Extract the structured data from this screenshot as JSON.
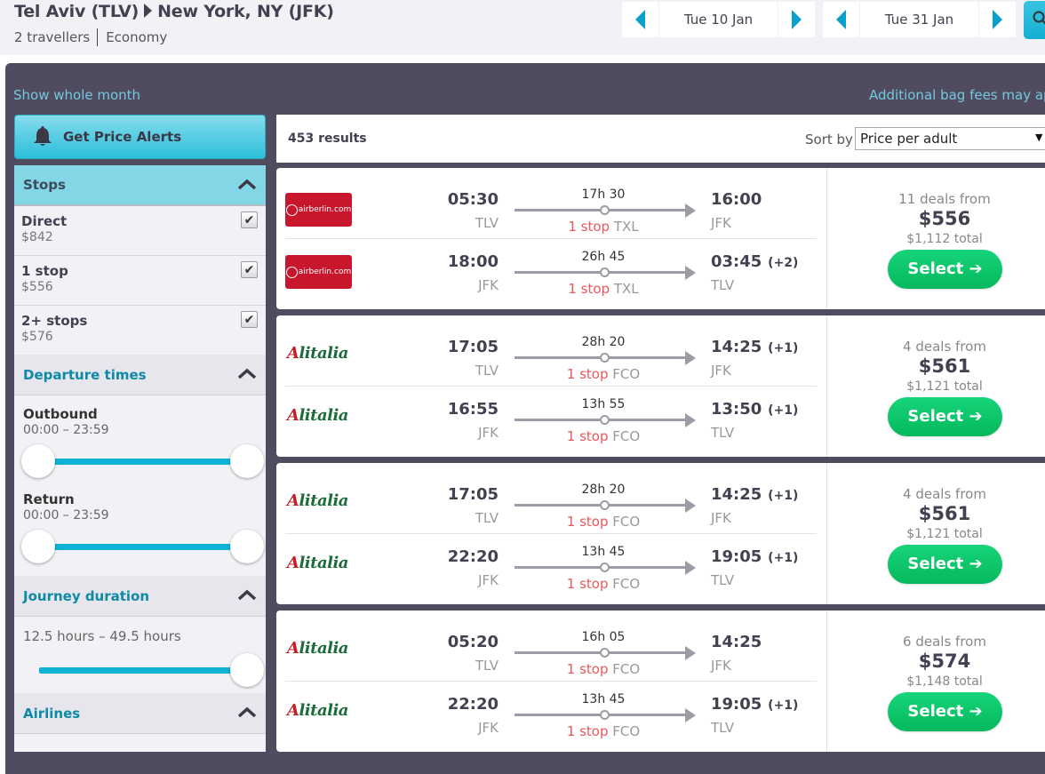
{
  "header": {
    "origin": "Tel Aviv (TLV)",
    "destination": "New York, NY (JFK)",
    "travellers": "2 travellers",
    "cabin": "Economy",
    "outbound_date": "Tue 10 Jan",
    "return_date": "Tue 31 Jan",
    "search_icon": "search-icon"
  },
  "links": {
    "show_whole_month": "Show whole month",
    "bag_fees": "Additional bag fees may apply"
  },
  "sidebar": {
    "price_alerts_label": "Get Price Alerts",
    "stops": {
      "title": "Stops",
      "options": [
        {
          "label": "Direct",
          "price": "$842",
          "checked": true
        },
        {
          "label": "1 stop",
          "price": "$556",
          "checked": true
        },
        {
          "label": "2+ stops",
          "price": "$576",
          "checked": true
        }
      ]
    },
    "departure_times": {
      "title": "Departure times",
      "outbound_label": "Outbound",
      "outbound_range": "00:00 – 23:59",
      "return_label": "Return",
      "return_range": "00:00 – 23:59"
    },
    "journey_duration": {
      "title": "Journey duration",
      "range": "12.5 hours – 49.5 hours"
    },
    "airlines": {
      "title": "Airlines"
    }
  },
  "results": {
    "count": "453 results",
    "sort_label": "Sort by",
    "sort_value": "Price per adult",
    "select_label": "Select ➔",
    "cards": [
      {
        "deals": "11 deals from",
        "price": "$556",
        "total": "$1,112 total",
        "legs": [
          {
            "airline": "airberlin.com",
            "dep_time": "05:30",
            "dep_airport": "TLV",
            "duration": "17h 30",
            "stops": "1 stop",
            "via": "TXL",
            "arr_time": "16:00",
            "day_offset": "",
            "arr_airport": "JFK"
          },
          {
            "airline": "airberlin.com",
            "dep_time": "18:00",
            "dep_airport": "JFK",
            "duration": "26h 45",
            "stops": "1 stop",
            "via": "TXL",
            "arr_time": "03:45",
            "day_offset": "(+2)",
            "arr_airport": "TLV"
          }
        ]
      },
      {
        "deals": "4 deals from",
        "price": "$561",
        "total": "$1,121 total",
        "legs": [
          {
            "airline": "Alitalia",
            "dep_time": "17:05",
            "dep_airport": "TLV",
            "duration": "28h 20",
            "stops": "1 stop",
            "via": "FCO",
            "arr_time": "14:25",
            "day_offset": "(+1)",
            "arr_airport": "JFK"
          },
          {
            "airline": "Alitalia",
            "dep_time": "16:55",
            "dep_airport": "JFK",
            "duration": "13h 55",
            "stops": "1 stop",
            "via": "FCO",
            "arr_time": "13:50",
            "day_offset": "(+1)",
            "arr_airport": "TLV"
          }
        ]
      },
      {
        "deals": "4 deals from",
        "price": "$561",
        "total": "$1,121 total",
        "legs": [
          {
            "airline": "Alitalia",
            "dep_time": "17:05",
            "dep_airport": "TLV",
            "duration": "28h 20",
            "stops": "1 stop",
            "via": "FCO",
            "arr_time": "14:25",
            "day_offset": "(+1)",
            "arr_airport": "JFK"
          },
          {
            "airline": "Alitalia",
            "dep_time": "22:20",
            "dep_airport": "JFK",
            "duration": "13h 45",
            "stops": "1 stop",
            "via": "FCO",
            "arr_time": "19:05",
            "day_offset": "(+1)",
            "arr_airport": "TLV"
          }
        ]
      },
      {
        "deals": "6 deals from",
        "price": "$574",
        "total": "$1,148 total",
        "legs": [
          {
            "airline": "Alitalia",
            "dep_time": "05:20",
            "dep_airport": "TLV",
            "duration": "16h 05",
            "stops": "1 stop",
            "via": "FCO",
            "arr_time": "14:25",
            "day_offset": "",
            "arr_airport": "JFK"
          },
          {
            "airline": "Alitalia",
            "dep_time": "22:20",
            "dep_airport": "JFK",
            "duration": "13h 45",
            "stops": "1 stop",
            "via": "FCO",
            "arr_time": "19:05",
            "day_offset": "(+1)",
            "arr_airport": "TLV"
          }
        ]
      }
    ]
  },
  "colors": {
    "accent": "#0aa0cc",
    "panel_bg": "#514b5f",
    "select_green": "#05b85d",
    "stop_red": "#e8585c"
  }
}
